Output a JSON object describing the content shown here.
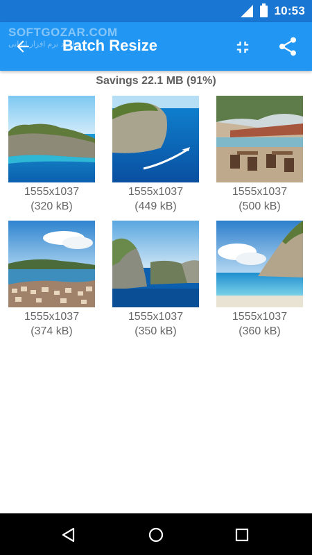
{
  "status_bar": {
    "time": "10:53",
    "icons": [
      "signal-icon",
      "battery-icon"
    ]
  },
  "toolbar": {
    "title": "Batch Resize",
    "watermark": "SOFTGOZAR.COM",
    "watermark_sub": "دانلود نرم افزار ایرانی",
    "actions": [
      "back-arrow-icon",
      "compress-icon",
      "share-icon"
    ],
    "color": "#2196f3"
  },
  "summary": {
    "savings": "Savings 22.1 MB (91%)"
  },
  "images": [
    {
      "dims": "1555x1037",
      "size": "(320 kB)",
      "scene": "island-cliff"
    },
    {
      "dims": "1555x1037",
      "size": "(449 kB)",
      "scene": "cliff-boat"
    },
    {
      "dims": "1555x1037",
      "size": "(500 kB)",
      "scene": "beach-cafe"
    },
    {
      "dims": "1555x1037",
      "size": "(374 kB)",
      "scene": "coastal-town"
    },
    {
      "dims": "1555x1037",
      "size": "(350 kB)",
      "scene": "bay-cliffs"
    },
    {
      "dims": "1555x1037",
      "size": "(360 kB)",
      "scene": "cliff-beach"
    }
  ],
  "nav_bar": {
    "buttons": [
      "back-triangle-icon",
      "home-circle-icon",
      "recents-square-icon"
    ]
  }
}
